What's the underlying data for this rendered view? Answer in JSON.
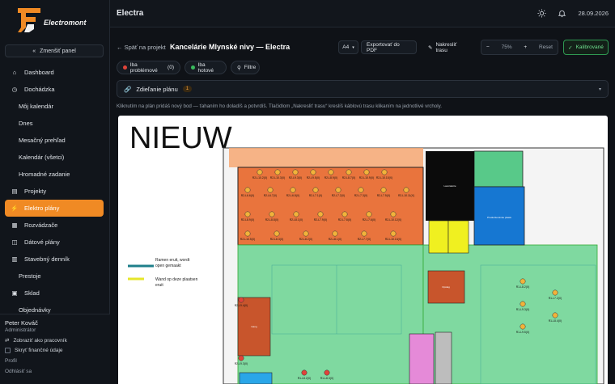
{
  "brand": {
    "name": "Electromont"
  },
  "sidebar": {
    "collapse_label": "Zmenšiť panel",
    "items": [
      {
        "label": "Dashboard",
        "icon": "home-icon",
        "sub": false,
        "active": false
      },
      {
        "label": "Dochádzka",
        "icon": "clock-icon",
        "sub": false,
        "active": false
      },
      {
        "label": "Môj kalendár",
        "icon": "",
        "sub": true,
        "active": false
      },
      {
        "label": "Dnes",
        "icon": "",
        "sub": true,
        "active": false
      },
      {
        "label": "Mesačný prehľad",
        "icon": "",
        "sub": true,
        "active": false
      },
      {
        "label": "Kalendár (všetci)",
        "icon": "",
        "sub": true,
        "active": false
      },
      {
        "label": "Hromadné zadanie",
        "icon": "",
        "sub": true,
        "active": false
      },
      {
        "label": "Projekty",
        "icon": "clipboard-icon",
        "sub": false,
        "active": false
      },
      {
        "label": "Elektro plány",
        "icon": "bolt-icon",
        "sub": false,
        "active": true
      },
      {
        "label": "Rozvádzače",
        "icon": "grid-icon",
        "sub": false,
        "active": false
      },
      {
        "label": "Dátové plány",
        "icon": "database-icon",
        "sub": false,
        "active": false
      },
      {
        "label": "Stavebný denník",
        "icon": "book-icon",
        "sub": false,
        "active": false
      },
      {
        "label": "Prestoje",
        "icon": "",
        "sub": true,
        "active": false
      },
      {
        "label": "Sklad",
        "icon": "box-icon",
        "sub": false,
        "active": false
      },
      {
        "label": "Objednávky",
        "icon": "",
        "sub": true,
        "active": false
      }
    ],
    "footer": {
      "user_name": "Peter Kováč",
      "user_role": "Administrátor",
      "worker_view": "Zobraziť ako pracovník",
      "hide_finance": "Skryť finančné údaje",
      "profile": "Profil",
      "logout": "Odhlásiť sa"
    }
  },
  "topbar": {
    "title": "Electra",
    "date": "28.09.2026"
  },
  "header": {
    "back": "← Späť na projekt",
    "title": "Kancelárie Mlynské nivy — Electra",
    "paper_size": "A4",
    "export": "Exportovať do PDF",
    "draw_route": "Nakresliť trasu",
    "zoom": "75%",
    "reset": "Reset",
    "calibrated": "Kalibrované"
  },
  "filters": {
    "problem_only": "Iba problémové",
    "problem_count": "(0)",
    "done_only": "Iba hotové",
    "filters": "Filtre"
  },
  "share_panel": {
    "label": "Zdieľanie plánu",
    "count": "1"
  },
  "hint": "Kliknutím na plán pridáš nový bod — ťahaním ho doladíš a potvrdíš. Tlačidlom „Nakresliť trasu“ kreslíš káblovú trasu klikaním na jednotlivé vrcholy.",
  "plan": {
    "stamp": "NIEUW",
    "legend": [
      {
        "text_1": "Ramen eruit, wordt",
        "text_2": "open gemaakt",
        "color": "#1f7f8a"
      },
      {
        "text_1": "Wand op deze plaatsen",
        "text_2": "eruit",
        "color": "#e6e62a"
      }
    ],
    "rooms": {
      "dark_room": "Lavoratorie",
      "blue_room": "Productieruimte plaats",
      "small_room": "Opslag",
      "lobby": "Gang"
    },
    "markers": {
      "row1": [
        "R2-L10.2(X)",
        "R2-L10.3(X)",
        "R2-L9.3(X)",
        "R2-L9.5(X)",
        "R2-L8.9(X)",
        "R2-L8.7(X)",
        "R2-L10.9(X)",
        "R2-L10.10(X)"
      ],
      "row2": [
        "R2-L6.6(X)",
        "R2-L6.7(X)",
        "R2-L6.8(X)",
        "R2-L7.1(X)",
        "R2-L7.2(X)",
        "R2-L7.3(X)",
        "R2-L7.5(X)",
        "R2-L10.11(X)"
      ],
      "row3": [
        "R2-L8.9(X)",
        "R2-L8.8(X)",
        "R2-L8.1(X)",
        "R2-L7.9(X)",
        "R2-L7.8(X)",
        "R2-L7.6(X)",
        "R2-L10.12(X)"
      ],
      "row4": [
        "R2-L10.5(X)",
        "R2-L8.3(X)",
        "R2-L8.2(X)",
        "R2-L8.1(X)",
        "R2-L7.7(X)",
        "R2-L10.13(X)"
      ],
      "right": [
        "R1-L8.2(X)",
        "R1-L7.2(X)",
        "R1-L9.3(X)",
        "R1-L8.4(X)",
        "R1-L9.5(X)"
      ],
      "left": [
        "R2-L9.4(X)",
        "R2-L9.3(X)"
      ],
      "bottom": [
        "R1-L8.2(X)",
        "R1-L8.3(X)"
      ]
    }
  }
}
